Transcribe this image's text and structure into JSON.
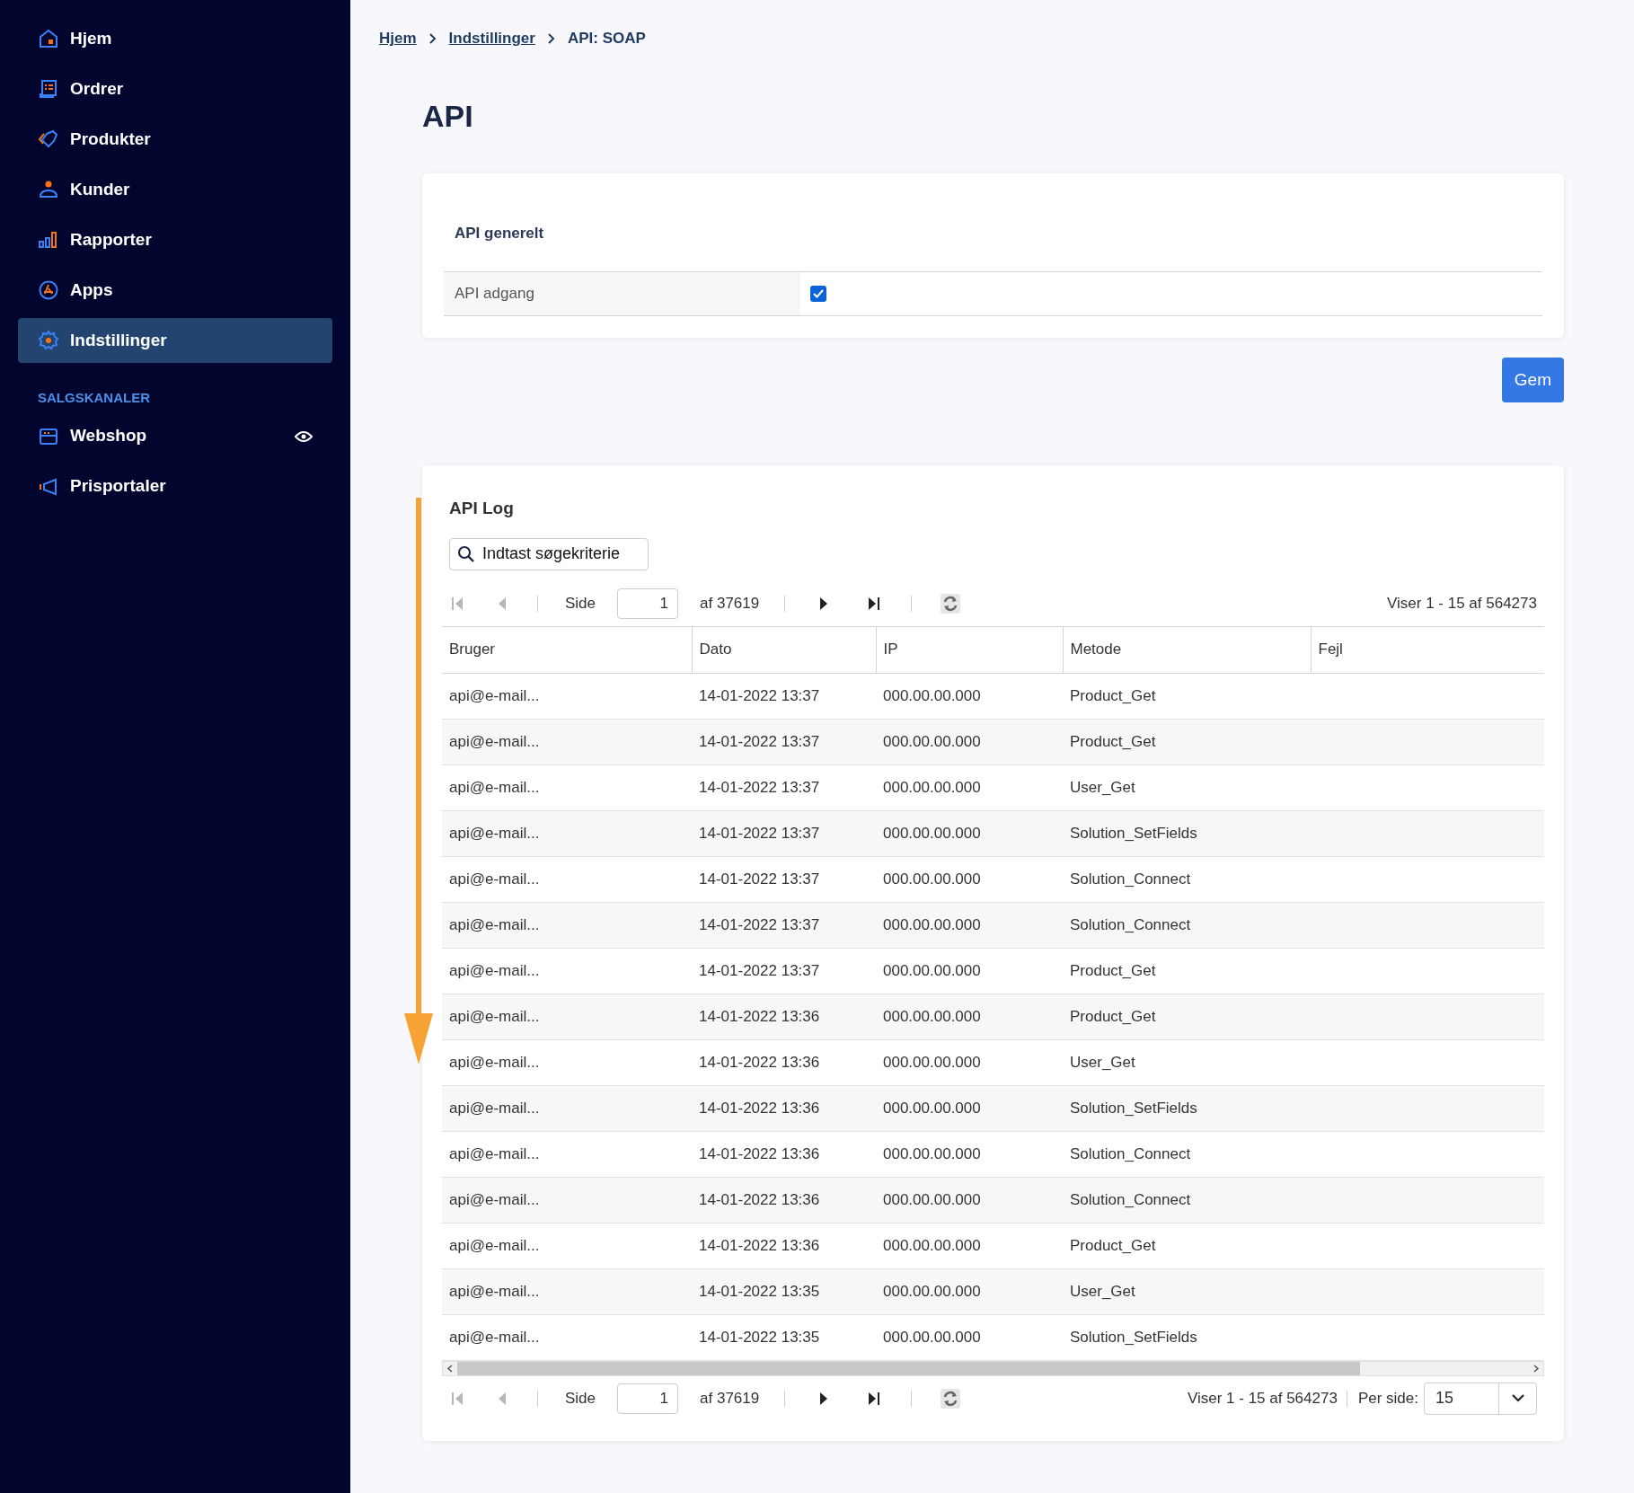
{
  "sidebar": {
    "items": [
      {
        "label": "Hjem",
        "kind": "home",
        "selected": false
      },
      {
        "label": "Ordrer",
        "kind": "orders",
        "selected": false
      },
      {
        "label": "Produkter",
        "kind": "tag",
        "selected": false
      },
      {
        "label": "Kunder",
        "kind": "user",
        "selected": false
      },
      {
        "label": "Rapporter",
        "kind": "chart",
        "selected": false
      },
      {
        "label": "Apps",
        "kind": "apps",
        "selected": false
      },
      {
        "label": "Indstillinger",
        "kind": "gear",
        "selected": true
      }
    ],
    "section_title": "SALGSKANALER",
    "channels": [
      {
        "label": "Webshop",
        "kind": "shop",
        "visible": true
      },
      {
        "label": "Prisportaler",
        "kind": "megaphone",
        "visible": false
      }
    ]
  },
  "breadcrumb": [
    {
      "label": "Hjem",
      "link": true
    },
    {
      "label": "Indstillinger",
      "link": true
    },
    {
      "label": "API: SOAP",
      "link": false
    }
  ],
  "title": "API",
  "general": {
    "title": "API generelt",
    "field": {
      "label": "API adgang",
      "checked": true
    }
  },
  "save_button": "Gem",
  "log": {
    "title": "API Log",
    "search": {
      "placeholder": "Indtast søgekriterie"
    },
    "pager": {
      "page_label": "Side",
      "page": "1",
      "of": "af 37619",
      "summary": "Viser 1 - 15 af 564273"
    },
    "columns": [
      "Bruger",
      "Dato",
      "IP",
      "Metode",
      "Fejl"
    ],
    "rows": [
      [
        "api@e-mail...",
        "14-01-2022 13:37",
        "000.00.00.000",
        "Product_Get"
      ],
      [
        "api@e-mail...",
        "14-01-2022 13:37",
        "000.00.00.000",
        "Product_Get"
      ],
      [
        "api@e-mail...",
        "14-01-2022 13:37",
        "000.00.00.000",
        "User_Get"
      ],
      [
        "api@e-mail...",
        "14-01-2022 13:37",
        "000.00.00.000",
        "Solution_SetFields"
      ],
      [
        "api@e-mail...",
        "14-01-2022 13:37",
        "000.00.00.000",
        "Solution_Connect"
      ],
      [
        "api@e-mail...",
        "14-01-2022 13:37",
        "000.00.00.000",
        "Solution_Connect"
      ],
      [
        "api@e-mail...",
        "14-01-2022 13:37",
        "000.00.00.000",
        "Product_Get"
      ],
      [
        "api@e-mail...",
        "14-01-2022 13:36",
        "000.00.00.000",
        "Product_Get"
      ],
      [
        "api@e-mail...",
        "14-01-2022 13:36",
        "000.00.00.000",
        "User_Get"
      ],
      [
        "api@e-mail...",
        "14-01-2022 13:36",
        "000.00.00.000",
        "Solution_SetFields"
      ],
      [
        "api@e-mail...",
        "14-01-2022 13:36",
        "000.00.00.000",
        "Solution_Connect"
      ],
      [
        "api@e-mail...",
        "14-01-2022 13:36",
        "000.00.00.000",
        "Solution_Connect"
      ],
      [
        "api@e-mail...",
        "14-01-2022 13:36",
        "000.00.00.000",
        "Product_Get"
      ],
      [
        "api@e-mail...",
        "14-01-2022 13:35",
        "000.00.00.000",
        "User_Get"
      ],
      [
        "api@e-mail...",
        "14-01-2022 13:35",
        "000.00.00.000",
        "Solution_SetFields"
      ]
    ],
    "bottom_pager": {
      "page_label": "Side",
      "page": "1",
      "of": "af 37619",
      "summary": "Viser 1 - 15 af 564273",
      "per_page_label": "Per side:",
      "per_page": "15"
    }
  }
}
